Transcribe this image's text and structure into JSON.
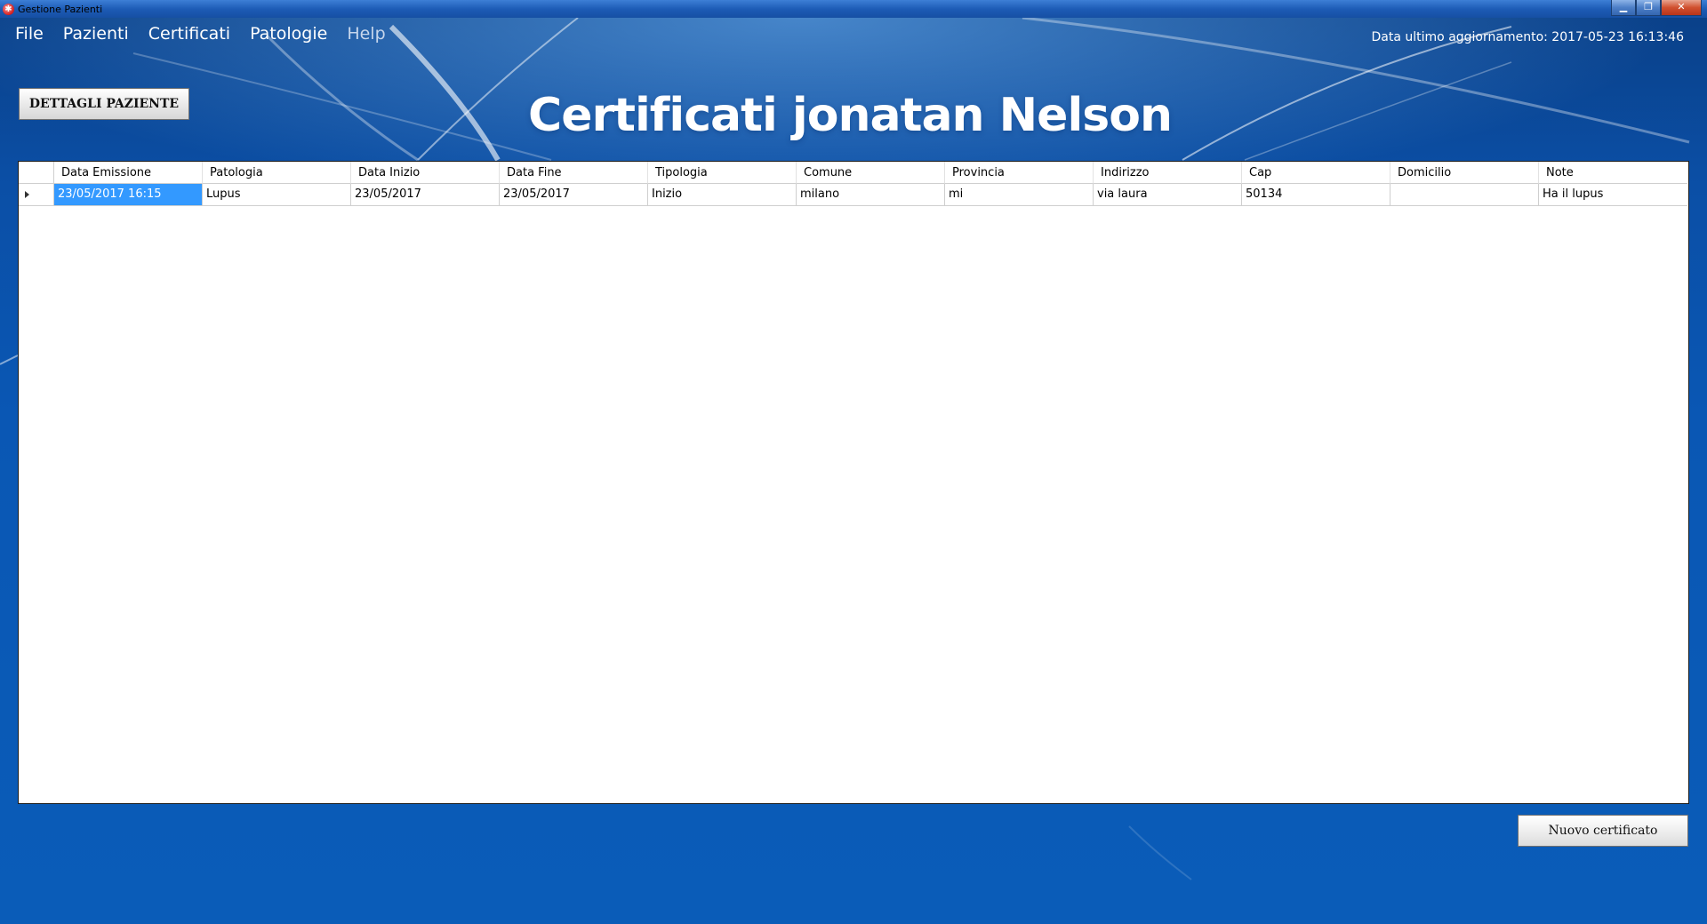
{
  "window": {
    "title": "Gestione Pazienti",
    "controls": {
      "minimize": "▁",
      "maximize": "❐",
      "close": "✕"
    }
  },
  "menu": {
    "items": [
      {
        "label": "File"
      },
      {
        "label": "Pazienti"
      },
      {
        "label": "Certificati"
      },
      {
        "label": "Patologie"
      },
      {
        "label": "Help"
      }
    ]
  },
  "status": {
    "last_update": "Data ultimo aggiornamento: 2017-05-23 16:13:46"
  },
  "buttons": {
    "details": "DETTAGLI PAZIENTE",
    "new_certificate": "Nuovo certificato"
  },
  "page": {
    "title": "Certificati jonatan Nelson"
  },
  "table": {
    "columns": [
      "Data Emissione",
      "Patologia",
      "Data Inizio",
      "Data Fine",
      "Tipologia",
      "Comune",
      "Provincia",
      "Indirizzo",
      "Cap",
      "Domicilio",
      "Note"
    ],
    "rows": [
      [
        "23/05/2017 16:15",
        "Lupus",
        "23/05/2017",
        "23/05/2017",
        "Inizio",
        "milano",
        "mi",
        "via laura",
        "50134",
        "",
        "Ha il lupus"
      ]
    ],
    "selected_row": 0,
    "selected_col": 0
  },
  "colors": {
    "background": "#0a5cb8",
    "selection": "#3399ff"
  }
}
